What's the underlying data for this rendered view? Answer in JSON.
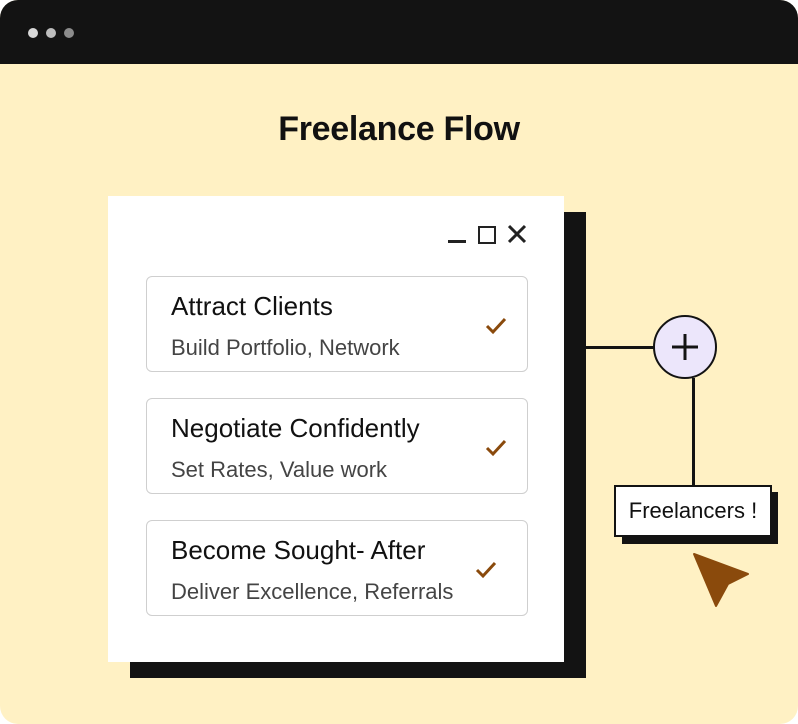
{
  "window": {
    "dots": [
      "#d9d9d9",
      "#bdbdbd",
      "#8c8c8c"
    ]
  },
  "page": {
    "title": "Freelance Flow"
  },
  "dialog": {
    "controls": [
      "minimize-icon",
      "maximize-icon",
      "close-icon"
    ],
    "cards": [
      {
        "title": "Attract Clients",
        "subtitle": "Build Portfolio, Network",
        "icon": "checkmark-icon"
      },
      {
        "title": "Negotiate Confidently",
        "subtitle": "Set Rates, Value work",
        "icon": "checkmark-icon"
      },
      {
        "title": "Become Sought- After",
        "subtitle": "Deliver Excellence, Referrals",
        "icon": "checkmark-icon"
      }
    ]
  },
  "callout": {
    "button_icon": "plus-icon",
    "label": "Freelancers !"
  },
  "colors": {
    "background": "#fff1c4",
    "titlebar": "#131313",
    "accent": "#8a4a0c",
    "plus_fill": "#ece6fb"
  }
}
